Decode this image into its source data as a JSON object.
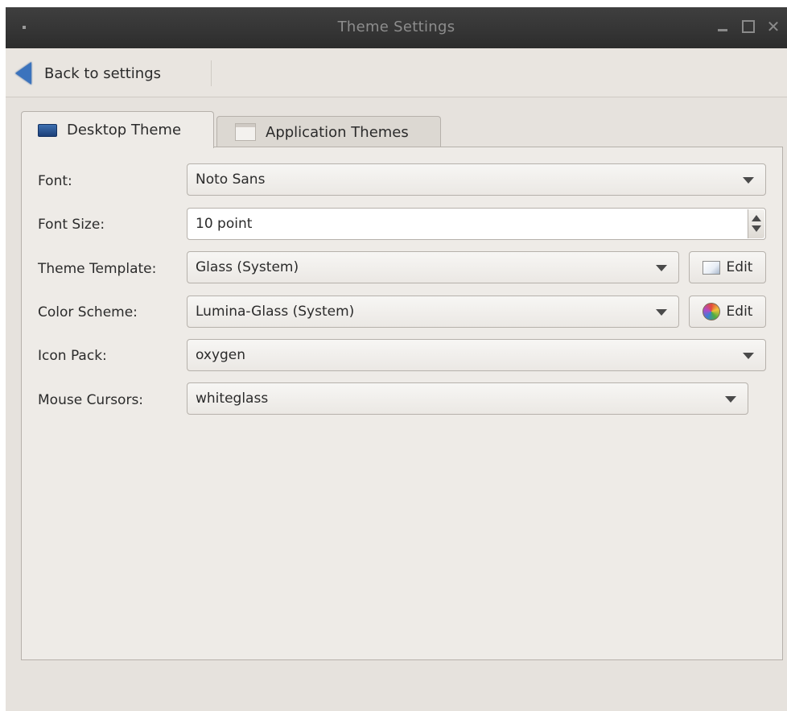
{
  "window": {
    "title": "Theme Settings"
  },
  "toolbar": {
    "back_label": "Back to settings"
  },
  "tabs": [
    {
      "label": "Desktop Theme",
      "active": true
    },
    {
      "label": "Application Themes",
      "active": false
    }
  ],
  "form": {
    "font": {
      "label": "Font:",
      "value": "Noto Sans"
    },
    "font_size": {
      "label": "Font Size:",
      "value": "10 point"
    },
    "theme_template": {
      "label": "Theme Template:",
      "value": "Glass (System)",
      "edit_label": "Edit"
    },
    "color_scheme": {
      "label": "Color Scheme:",
      "value": "Lumina-Glass (System)",
      "edit_label": "Edit"
    },
    "icon_pack": {
      "label": "Icon Pack:",
      "value": "oxygen"
    },
    "mouse_cursors": {
      "label": "Mouse Cursors:",
      "value": "whiteglass"
    }
  },
  "colors": {
    "titlebar": "#333333",
    "window_bg": "#e6e2dd",
    "panel_bg": "#eeebe7",
    "accent_arrow": "#3b73bd"
  }
}
